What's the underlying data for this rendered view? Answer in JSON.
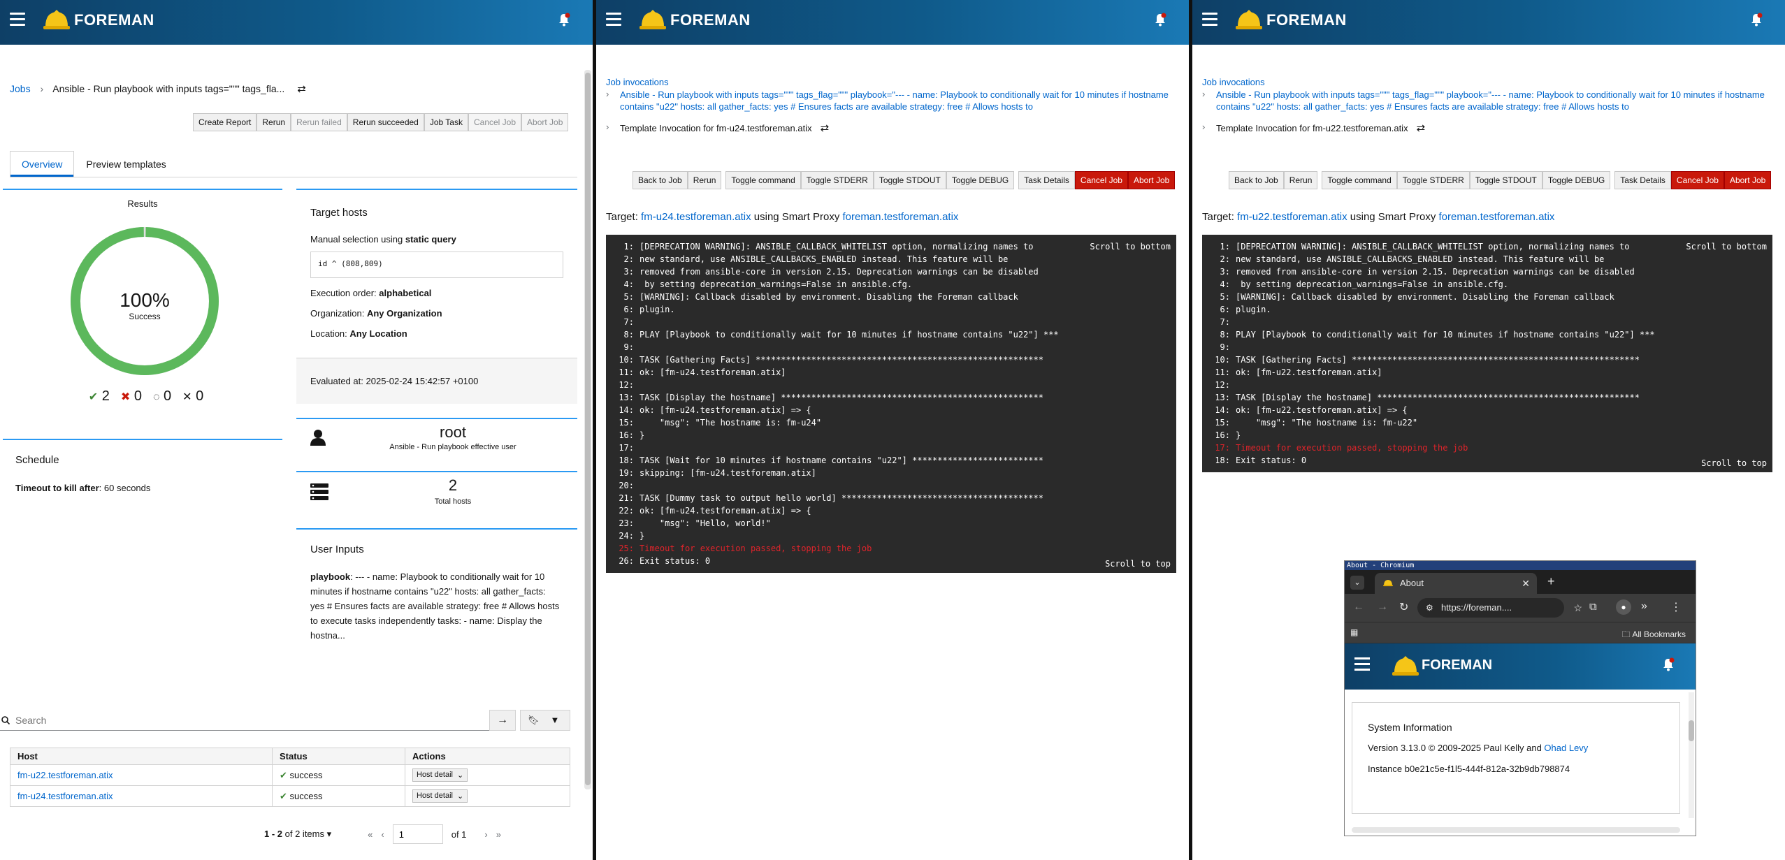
{
  "brand": "FOREMAN",
  "left": {
    "breadcrumb": {
      "jobs": "Jobs",
      "current": "Ansible - Run playbook with inputs tags=\"\"\" tags_fla..."
    },
    "actions": [
      "Create Report",
      "Rerun",
      "Rerun failed",
      "Rerun succeeded",
      "Job Task",
      "Cancel Job",
      "Abort Job"
    ],
    "tabs": [
      "Overview",
      "Preview templates"
    ],
    "results": {
      "title": "Results",
      "percent": "100%",
      "label": "Success",
      "counts": {
        "success": "2",
        "failed": "0",
        "in_progress": "0",
        "cancelled": "0"
      },
      "success_fraction": 1.0
    },
    "target": {
      "title": "Target hosts",
      "manual_prefix": "Manual selection using ",
      "manual_query": "static query",
      "query": "id ^ (808,809)",
      "order_label": "Execution order: ",
      "order_value": "alphabetical",
      "org_label": "Organization: ",
      "org_value": "Any Organization",
      "loc_label": "Location: ",
      "loc_value": "Any Location"
    },
    "evaluated": "Evaluated at: 2025-02-24 15:42:57 +0100",
    "user": {
      "name": "root",
      "sub": "Ansible - Run playbook effective user"
    },
    "hosts_total": {
      "value": "2",
      "label": "Total hosts"
    },
    "schedule": {
      "title": "Schedule",
      "timeout_label": "Timeout to kill after",
      "timeout_value": ": 60 seconds"
    },
    "inputs": {
      "title": "User Inputs",
      "key": "playbook",
      "value": ": --- - name: Playbook to conditionally wait for 10 minutes if hostname contains \"u22\" hosts: all gather_facts: yes # Ensures facts are available strategy: free # Allows hosts to execute tasks independently tasks: - name: Display the hostna..."
    },
    "search_placeholder": "Search",
    "table": {
      "headers": [
        "Host",
        "Status",
        "Actions"
      ],
      "rows": [
        {
          "host": "fm-u22.testforeman.atix",
          "status": "success",
          "action": "Host detail"
        },
        {
          "host": "fm-u24.testforeman.atix",
          "status": "success",
          "action": "Host detail"
        }
      ]
    },
    "pagination": {
      "range": "1 - 2",
      "of_items": "of 2 items",
      "page": "1",
      "of_pages": "of 1"
    }
  },
  "middle": {
    "breadcrumb_root": "Job invocations",
    "breadcrumb_job": "Ansible - Run playbook with inputs tags=\"\"\" tags_flag=\"\"\" playbook=\"--- - name: Playbook to conditionally wait for 10 minutes if hostname contains \"u22\" hosts: all gather_facts: yes # Ensures facts are available strategy: free # Allows hosts to",
    "breadcrumb_current": "Template Invocation for fm-u24.testforeman.atix",
    "actions": [
      "Back to Job",
      "Rerun",
      "Toggle command",
      "Toggle STDERR",
      "Toggle STDOUT",
      "Toggle DEBUG",
      "Task Details",
      "Cancel Job",
      "Abort Job"
    ],
    "target_prefix": "Target: ",
    "target_host": "fm-u24.testforeman.atix",
    "target_mid": " using Smart Proxy ",
    "proxy": "foreman.testforeman.atix",
    "scroll_bottom": "Scroll to bottom",
    "scroll_top": "Scroll to top",
    "lines": [
      {
        "n": "1:",
        "t": "[DEPRECATION WARNING]: ANSIBLE_CALLBACK_WHITELIST option, normalizing names to"
      },
      {
        "n": "2:",
        "t": "new standard, use ANSIBLE_CALLBACKS_ENABLED instead. This feature will be"
      },
      {
        "n": "3:",
        "t": "removed from ansible-core in version 2.15. Deprecation warnings can be disabled"
      },
      {
        "n": "4:",
        "t": " by setting deprecation_warnings=False in ansible.cfg."
      },
      {
        "n": "5:",
        "t": "[WARNING]: Callback disabled by environment. Disabling the Foreman callback"
      },
      {
        "n": "6:",
        "t": "plugin."
      },
      {
        "n": "7:",
        "t": ""
      },
      {
        "n": "8:",
        "t": "PLAY [Playbook to conditionally wait for 10 minutes if hostname contains \"u22\"] ***"
      },
      {
        "n": "9:",
        "t": ""
      },
      {
        "n": "10:",
        "t": "TASK [Gathering Facts] *********************************************************"
      },
      {
        "n": "11:",
        "t": "ok: [fm-u24.testforeman.atix]"
      },
      {
        "n": "12:",
        "t": ""
      },
      {
        "n": "13:",
        "t": "TASK [Display the hostname] ****************************************************"
      },
      {
        "n": "14:",
        "t": "ok: [fm-u24.testforeman.atix] => {"
      },
      {
        "n": "15:",
        "t": "    \"msg\": \"The hostname is: fm-u24\""
      },
      {
        "n": "16:",
        "t": "}"
      },
      {
        "n": "17:",
        "t": ""
      },
      {
        "n": "18:",
        "t": "TASK [Wait for 10 minutes if hostname contains \"u22\"] **************************"
      },
      {
        "n": "19:",
        "t": "skipping: [fm-u24.testforeman.atix]"
      },
      {
        "n": "20:",
        "t": ""
      },
      {
        "n": "21:",
        "t": "TASK [Dummy task to output hello world] ****************************************"
      },
      {
        "n": "22:",
        "t": "ok: [fm-u24.testforeman.atix] => {"
      },
      {
        "n": "23:",
        "t": "    \"msg\": \"Hello, world!\""
      },
      {
        "n": "24:",
        "t": "}"
      },
      {
        "n": "25:",
        "t": "Timeout for execution passed, stopping the job",
        "err": true
      },
      {
        "n": "26:",
        "t": "Exit status: 0"
      }
    ]
  },
  "right": {
    "breadcrumb_root": "Job invocations",
    "breadcrumb_job": "Ansible - Run playbook with inputs tags=\"\"\" tags_flag=\"\"\" playbook=\"--- - name: Playbook to conditionally wait for 10 minutes if hostname contains \"u22\" hosts: all gather_facts: yes # Ensures facts are available strategy: free # Allows hosts to",
    "breadcrumb_current": "Template Invocation for fm-u22.testforeman.atix",
    "actions": [
      "Back to Job",
      "Rerun",
      "Toggle command",
      "Toggle STDERR",
      "Toggle STDOUT",
      "Toggle DEBUG",
      "Task Details",
      "Cancel Job",
      "Abort Job"
    ],
    "target_prefix": "Target: ",
    "target_host": "fm-u22.testforeman.atix",
    "target_mid": " using Smart Proxy ",
    "proxy": "foreman.testforeman.atix",
    "scroll_bottom": "Scroll to bottom",
    "scroll_top": "Scroll to top",
    "lines": [
      {
        "n": "1:",
        "t": "[DEPRECATION WARNING]: ANSIBLE_CALLBACK_WHITELIST option, normalizing names to"
      },
      {
        "n": "2:",
        "t": "new standard, use ANSIBLE_CALLBACKS_ENABLED instead. This feature will be"
      },
      {
        "n": "3:",
        "t": "removed from ansible-core in version 2.15. Deprecation warnings can be disabled"
      },
      {
        "n": "4:",
        "t": " by setting deprecation_warnings=False in ansible.cfg."
      },
      {
        "n": "5:",
        "t": "[WARNING]: Callback disabled by environment. Disabling the Foreman callback"
      },
      {
        "n": "6:",
        "t": "plugin."
      },
      {
        "n": "7:",
        "t": ""
      },
      {
        "n": "8:",
        "t": "PLAY [Playbook to conditionally wait for 10 minutes if hostname contains \"u22\"] ***"
      },
      {
        "n": "9:",
        "t": ""
      },
      {
        "n": "10:",
        "t": "TASK [Gathering Facts] *********************************************************"
      },
      {
        "n": "11:",
        "t": "ok: [fm-u22.testforeman.atix]"
      },
      {
        "n": "12:",
        "t": ""
      },
      {
        "n": "13:",
        "t": "TASK [Display the hostname] ****************************************************"
      },
      {
        "n": "14:",
        "t": "ok: [fm-u22.testforeman.atix] => {"
      },
      {
        "n": "15:",
        "t": "    \"msg\": \"The hostname is: fm-u22\""
      },
      {
        "n": "16:",
        "t": "}"
      },
      {
        "n": "17:",
        "t": "Timeout for execution passed, stopping the job",
        "err": true
      },
      {
        "n": "18:",
        "t": "Exit status: 0"
      }
    ]
  },
  "browser": {
    "window_title": "About - Chromium",
    "tab_title": "About",
    "url": "https://foreman....",
    "bookmarks": "All Bookmarks",
    "system_info_title": "System Information",
    "version_text": "Version 3.13.0 © 2009-2025 Paul Kelly and ",
    "version_link": "Ohad Levy",
    "instance": "Instance b0e21c5e-f1l5-444f-812a-32b9db798874"
  },
  "colors": {
    "masthead": "#0f5a8a",
    "link": "#0066cc",
    "success": "#3e8635",
    "danger": "#c9190b",
    "console_bg": "#2a2a2a"
  }
}
